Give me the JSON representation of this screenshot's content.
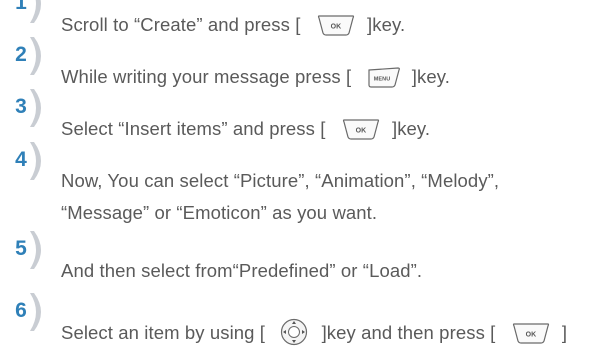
{
  "steps": [
    {
      "number": "1",
      "before": "Scroll to “Create” and press [",
      "key_icon": "ok-key-icon",
      "after": "]key."
    },
    {
      "number": "2",
      "before": "While writing your message press [",
      "key_icon": "menu-key-icon",
      "after": "]key."
    },
    {
      "number": "3",
      "before": "Select “Insert items” and press [",
      "key_icon": "ok-key-icon",
      "after": "]key."
    },
    {
      "number": "4",
      "line1": "Now, You can select “Picture”, “Animation”, “Melody”,",
      "line2": "“Message” or “Emoticon” as you want."
    },
    {
      "number": "5",
      "text": "And then select from“Predefined” or  “Load”."
    },
    {
      "number": "6",
      "before": "Select an item by using [",
      "nav_icon": "navigation-key-icon",
      "middle": "]key and then press [",
      "key_icon": "ok-key-icon",
      "after": "]"
    }
  ],
  "key_labels": {
    "ok": "OK",
    "menu": "MENU"
  },
  "colors": {
    "number": "#2f80b8",
    "text": "#5a5a5a",
    "badge_shadow": "#c8ccd2"
  }
}
